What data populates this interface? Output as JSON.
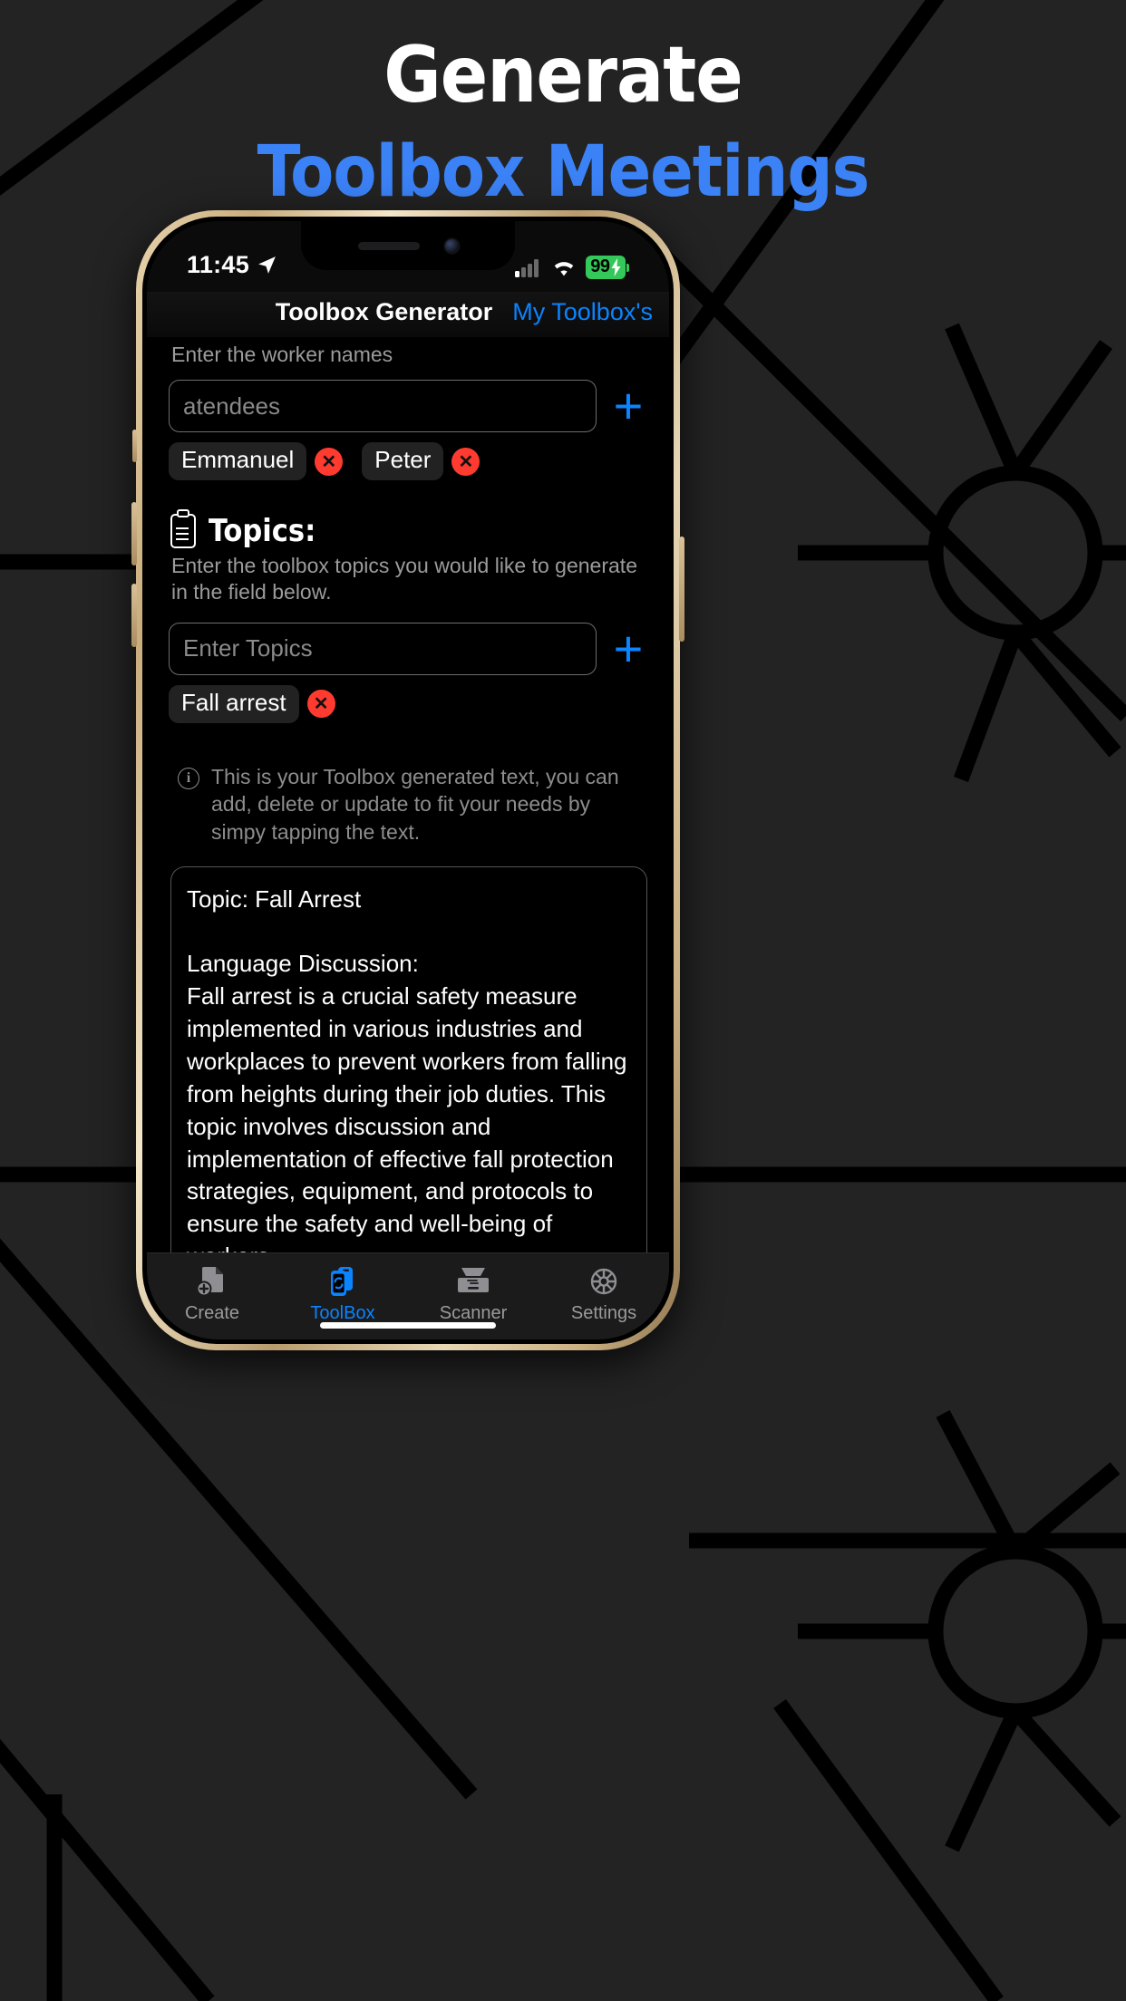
{
  "promo": {
    "headline_line1": "Generate",
    "headline_line2": "Toolbox Meetings",
    "accent_color": "#3b82f6"
  },
  "status_bar": {
    "time": "11:45",
    "location_icon": "location-arrow-icon",
    "signal_icon": "cellular-signal-icon",
    "wifi_icon": "wifi-icon",
    "battery_level": "99",
    "battery_charging_icon": "lightning-bolt-icon"
  },
  "nav": {
    "title": "Toolbox Generator",
    "link_label": "My Toolbox's"
  },
  "attendees": {
    "label": "Enter the worker names",
    "input_value": "",
    "placeholder": "atendees",
    "add_button_icon": "plus-icon",
    "chips": [
      {
        "label": "Emmanuel",
        "remove_icon": "x-circle-icon"
      },
      {
        "label": "Peter",
        "remove_icon": "x-circle-icon"
      }
    ]
  },
  "topics": {
    "icon": "clipboard-icon",
    "heading": "Topics:",
    "helper": "Enter the toolbox topics you would like to generate in the field below.",
    "input_value": "",
    "placeholder": "Enter Topics",
    "add_button_icon": "plus-icon",
    "chips": [
      {
        "label": "Fall arrest",
        "remove_icon": "x-circle-icon"
      }
    ]
  },
  "note": {
    "icon": "info-circle-icon",
    "text": "This is your Toolbox generated text, you can add, delete or update to fit your needs by simpy tapping the text."
  },
  "generated": {
    "text": "Topic: Fall Arrest\n\nLanguage Discussion:\nFall arrest is a crucial safety measure implemented in various industries and workplaces to prevent workers from falling from heights during their job duties. This topic involves discussion and implementation of effective fall protection strategies, equipment, and protocols to ensure the safety and well-being of workers.\n\nImportance of the Topic:\nThe importance of fall arrest cannot be emphasized enough when it comes to safeguarding the lives of workers who perform tasks at elevated heights. Falls from heights can lead to severe injuries, long-term"
  },
  "tabbar": {
    "active": "ToolBox",
    "active_color": "#0a84ff",
    "inactive_color": "#9b9b9b",
    "items": [
      {
        "label": "Create",
        "icon": "document-plus-icon"
      },
      {
        "label": "ToolBox",
        "icon": "phone-sync-icon"
      },
      {
        "label": "Scanner",
        "icon": "scanner-icon"
      },
      {
        "label": "Settings",
        "icon": "gear-icon"
      }
    ]
  }
}
